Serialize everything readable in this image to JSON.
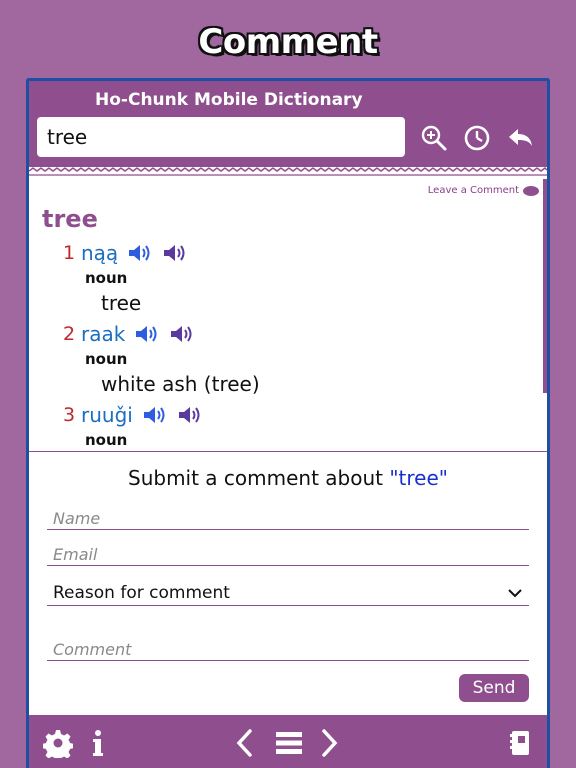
{
  "banner": {
    "title": "Comment"
  },
  "app": {
    "title": "Ho-Chunk Mobile Dictionary"
  },
  "search": {
    "value": "tree"
  },
  "entry": {
    "leave_comment": "Leave a Comment",
    "headword": "tree",
    "senses": [
      {
        "num": "1",
        "word": "nąą",
        "pos": "noun",
        "gloss": "tree"
      },
      {
        "num": "2",
        "word": "raak",
        "pos": "noun",
        "gloss": "white ash (tree)"
      },
      {
        "num": "3",
        "word": "ruuǧi",
        "pos": "noun",
        "gloss": ""
      }
    ]
  },
  "comment_form": {
    "title_prefix": "Submit a comment about ",
    "title_word": "\"tree\"",
    "name_placeholder": "Name",
    "email_placeholder": "Email",
    "reason_selected": "Reason for comment",
    "comment_placeholder": "Comment",
    "send_label": "Send"
  },
  "icons": {
    "header": [
      "zoom-in-icon",
      "history-icon",
      "back-arrow-icon"
    ],
    "footer": [
      "gear-icon",
      "info-icon",
      "chevron-left-icon",
      "menu-icon",
      "chevron-right-icon",
      "book-icon"
    ]
  },
  "colors": {
    "brand": "#8f4f8e",
    "background": "#a0689f",
    "sense_number": "#c0272d",
    "sense_word": "#1c6fc0",
    "speaker_blue": "#2f5de0",
    "speaker_purple": "#5b3aa0"
  }
}
